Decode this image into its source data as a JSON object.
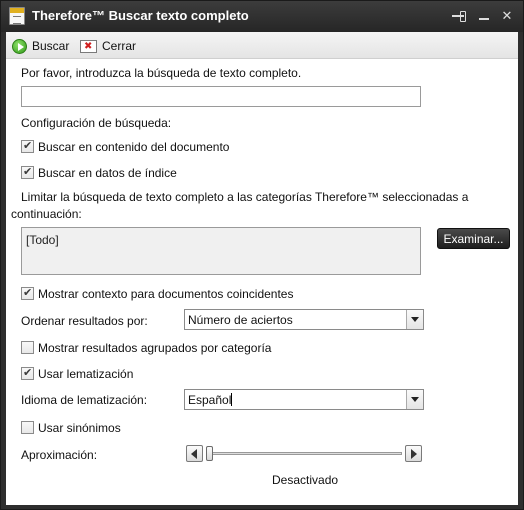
{
  "window": {
    "title": "Therefore™ Buscar texto completo",
    "pin_icon": "pin-icon",
    "minimize_icon": "minimize-icon",
    "close_icon": "close-icon",
    "close_glyph": "✕"
  },
  "toolbar": {
    "search_label": "Buscar",
    "search_icon": "go-icon",
    "close_label": "Cerrar",
    "close_icon": "cancel-icon"
  },
  "form": {
    "prompt": "Por favor, introduzca la búsqueda de texto completo.",
    "search_value": "",
    "config_heading": "Configuración de búsqueda:",
    "search_content_label": "Buscar en contenido del documento",
    "search_content_checked": true,
    "search_index_label": "Buscar en datos de índice",
    "search_index_checked": true,
    "limit_text": "Limitar la búsqueda de texto completo a las categorías Therefore™ seleccionadas a continuación:",
    "categories_value": "[Todo]",
    "browse_label": "Examinar...",
    "show_context_label": "Mostrar contexto para documentos coincidentes",
    "show_context_checked": true,
    "sort_label": "Ordenar resultados por:",
    "sort_value": "Número de aciertos",
    "group_label": "Mostrar resultados agrupados por categoría",
    "group_checked": false,
    "lemma_label": "Usar lematización",
    "lemma_checked": true,
    "lemma_lang_label": "Idioma de lematización:",
    "lemma_lang_value": "Español",
    "synonyms_label": "Usar sinónimos",
    "synonyms_checked": false,
    "approx_label": "Aproximación:",
    "approx_level": 0,
    "approx_status": "Desactivado"
  },
  "colors": {
    "titlebar": "#2e2e2e",
    "toolbar": "#ececec",
    "button_dark": "#2a2a2a"
  }
}
